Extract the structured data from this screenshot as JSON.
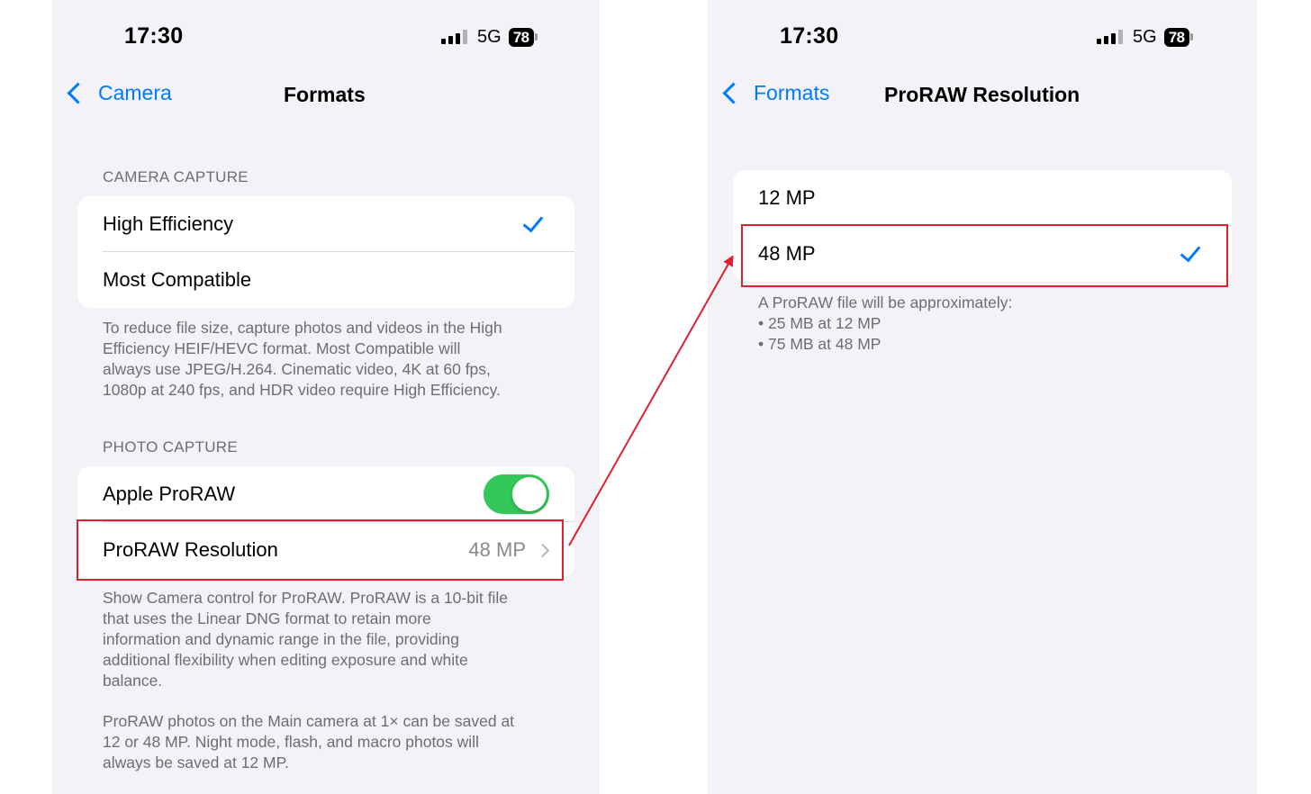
{
  "left": {
    "status": {
      "time": "17:30",
      "network": "5G",
      "battery": "78"
    },
    "nav": {
      "back_label": "Camera",
      "title": "Formats"
    },
    "camera_capture": {
      "header": "CAMERA CAPTURE",
      "options": [
        "High Efficiency",
        "Most Compatible"
      ],
      "selected": "High Efficiency",
      "footnote": [
        "To reduce file size, capture photos and videos in the High",
        "Efficiency HEIF/HEVC format. Most Compatible will",
        "always use JPEG/H.264. Cinematic video, 4K at 60 fps,",
        "1080p at 240 fps, and HDR video require High Efficiency."
      ]
    },
    "photo_capture": {
      "header": "PHOTO CAPTURE",
      "proraw_label": "Apple ProRAW",
      "proraw_enabled": true,
      "resolution_label": "ProRAW Resolution",
      "resolution_value": "48 MP",
      "footnote1": [
        "Show Camera control for ProRAW. ProRAW is a 10-bit file",
        "that uses the Linear DNG format to retain more",
        "information and dynamic range in the file, providing",
        "additional flexibility when editing exposure and white",
        "balance."
      ],
      "footnote2": [
        "ProRAW photos on the Main camera at 1× can be saved at",
        "12 or 48 MP. Night mode, flash, and macro photos will",
        "always be saved at 12 MP."
      ]
    }
  },
  "right": {
    "status": {
      "time": "17:30",
      "network": "5G",
      "battery": "78"
    },
    "nav": {
      "back_label": "Formats",
      "title": "ProRAW Resolution"
    },
    "options": [
      "12 MP",
      "48 MP"
    ],
    "selected": "48 MP",
    "footnote": [
      "A ProRAW file will be approximately:",
      "• 25 MB at 12 MP",
      "• 75 MB at 48 MP"
    ]
  },
  "colors": {
    "accent": "#007aff",
    "toggle_on": "#34c759",
    "annotation": "#e0202e",
    "background": "#f2f2f7"
  }
}
